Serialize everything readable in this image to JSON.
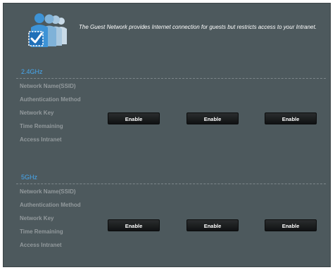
{
  "intro_text": "The Guest Network provides Internet connection for guests but restricts access to your Intranet.",
  "colors": {
    "panel_bg": "#4d595d",
    "band_title": "#46a8f0",
    "label": "#939a9d",
    "button_bg": "#15191a"
  },
  "bands": [
    {
      "title": "2.4GHz",
      "labels": [
        "Network Name(SSID)",
        "Authentication Method",
        "Network Key",
        "Time Remaining",
        "Access Intranet"
      ],
      "buttons": [
        "Enable",
        "Enable",
        "Enable"
      ]
    },
    {
      "title": "5GHz",
      "labels": [
        "Network Name(SSID)",
        "Authentication Method",
        "Network Key",
        "Time Remaining",
        "Access Intranet"
      ],
      "buttons": [
        "Enable",
        "Enable",
        "Enable"
      ]
    }
  ]
}
